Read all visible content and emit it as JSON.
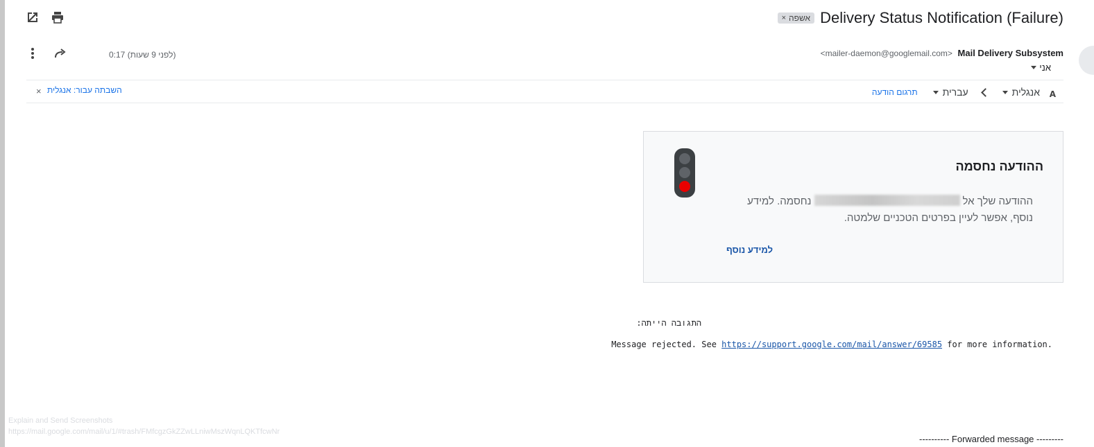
{
  "toolbar": {
    "open_new_window_icon": "open-in-new-window-icon",
    "print_icon": "print-icon",
    "more_icon": "more-vert-icon",
    "forward_icon": "forward-icon"
  },
  "email": {
    "subject": "Delivery Status Notification (Failure)",
    "label_chip": "אשפה",
    "sender_name": "Mail Delivery Subsystem",
    "sender_email": "<mailer-daemon@googlemail.com>",
    "to": "אני",
    "time": "0:17 (לפני 9 שעות)"
  },
  "translate_bar": {
    "from_lang": "אנגלית",
    "to_lang": "עברית",
    "translate_link": "תרגום הודעה",
    "disable_link": "השבתה עבור: אנגלית",
    "close": "×"
  },
  "card": {
    "title": "ההודעה נחסמה",
    "body_before": "ההודעה שלך אל",
    "body_after": "נחסמה. למידע נוסף, אפשר לעיין בפרטים הטכניים שלמטה.",
    "learn_more": "למידע נוסף",
    "colors": {
      "light_off": "#5f6368",
      "light_red": "#ea0000",
      "housing": "#3c4043"
    }
  },
  "body": {
    "answer_label": "התגובה הייתה:",
    "reject_before": "Message rejected. See ",
    "reject_link": "https://support.google.com/mail/answer/69585",
    "reject_after": " for more information.",
    "forwarded": "---------- Forwarded message ---------"
  },
  "overlay": {
    "line1": "Explain and Send Screenshots",
    "line2": "https://mail.google.com/mail/u/1/#trash/FMfcgzGkZZwLLniwMszWqnLQKTfcwNr"
  }
}
